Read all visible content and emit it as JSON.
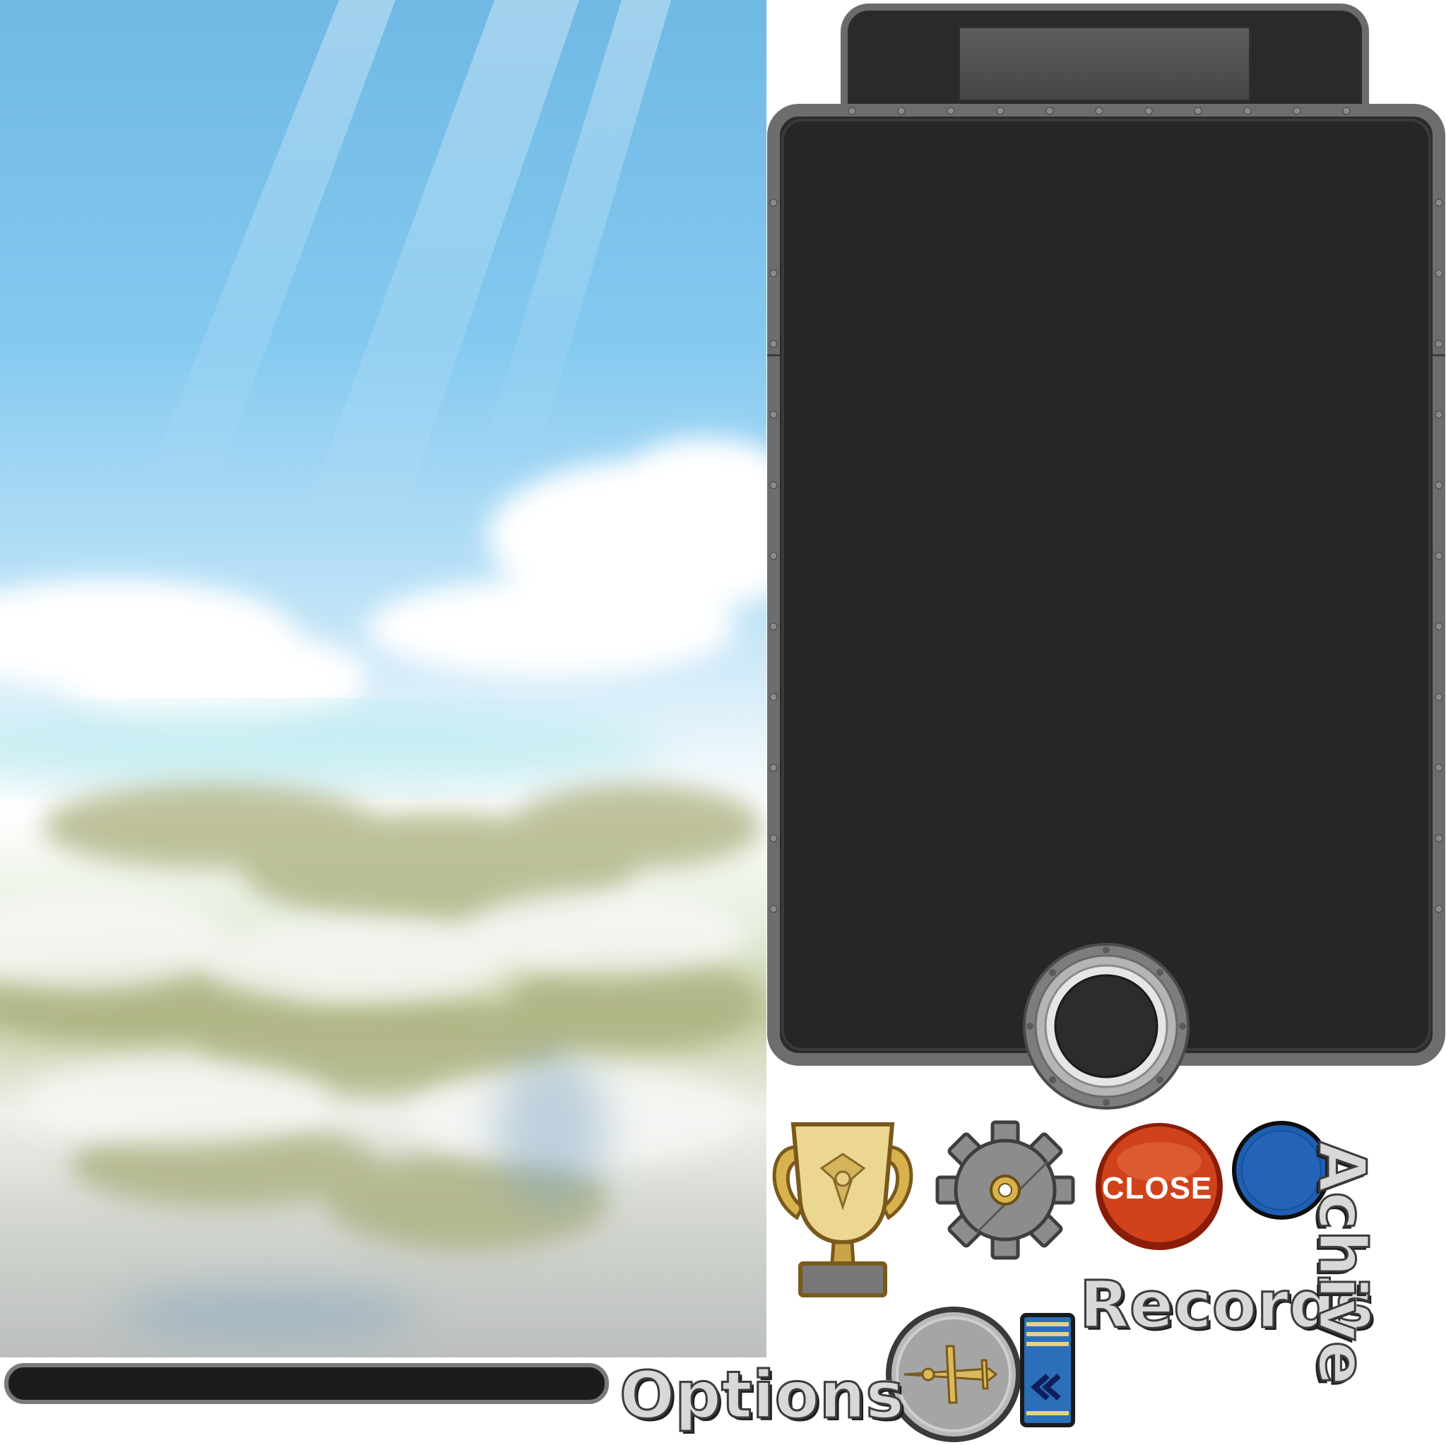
{
  "labels": {
    "options": "Options",
    "records": "Records",
    "achive": "Achive"
  },
  "buttons": {
    "close": "CLOSE"
  },
  "icons": {
    "trophy": "trophy-icon",
    "gear": "gear-icon",
    "close": "close-button",
    "blue_button": "blue-round-button",
    "plane_badge": "plane-badge-icon",
    "rank_tab": "rank-chevron-icon",
    "porthole": "porthole-button"
  },
  "colors": {
    "panel": "#2b2b2b",
    "frame": "#6d6d6d",
    "close_red": "#d2401a",
    "blue": "#1a5fb0",
    "gold": "#e4c46a",
    "sky": "#7cc4ee"
  }
}
